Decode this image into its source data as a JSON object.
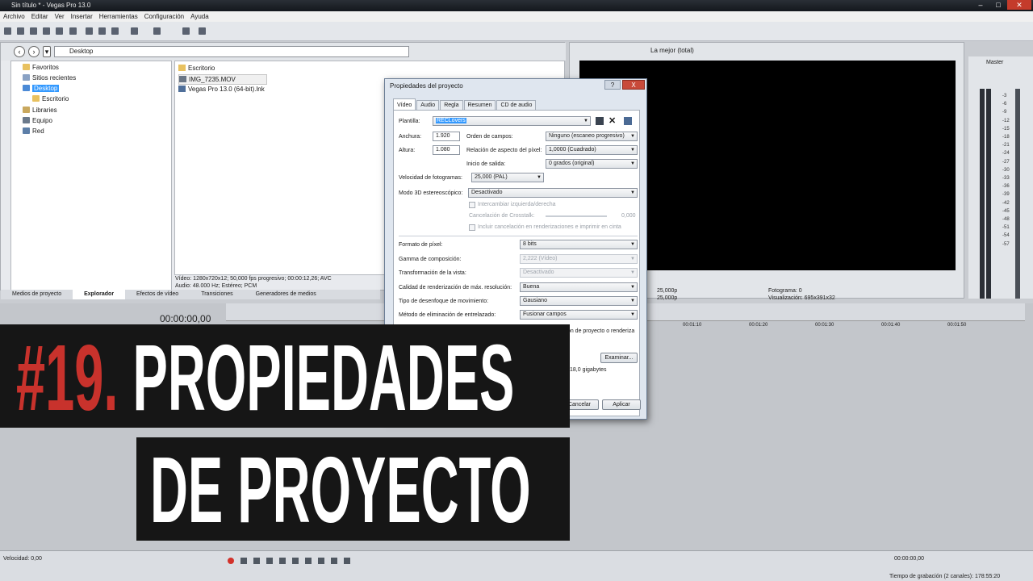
{
  "window": {
    "title": "Sin título * - Vegas Pro 13.0"
  },
  "menu": [
    "Archivo",
    "Editar",
    "Ver",
    "Insertar",
    "Herramientas",
    "Configuración",
    "Ayuda"
  ],
  "explorer": {
    "path": "Desktop",
    "tree": [
      "Favoritos",
      "Sitios recientes",
      "Desktop",
      "Escritorio",
      "Libraries",
      "Equipo",
      "Red"
    ],
    "files": [
      "Escritorio",
      "IMG_7235.MOV",
      "Vegas Pro 13.0 (64-bit).lnk"
    ],
    "info_line1": "Vídeo: 1280x720x12; 50,000 fps progresivo; 00:00:12,26; AVC",
    "info_line2": "Audio: 48.000 Hz; Estéreo; PCM",
    "tabs": [
      "Medios de proyecto",
      "Explorador",
      "Efectos de vídeo",
      "Transiciones",
      "Generadores de medios"
    ]
  },
  "preview": {
    "quality": "La mejor (total)",
    "project": "25,000p",
    "preview_val": "25,000p",
    "frame_label": "Fotograma:",
    "frame": "0",
    "display_label": "Visualización:",
    "display": "695x391x32"
  },
  "master": {
    "label": "Master",
    "scale": [
      "3",
      "6",
      "9",
      "12",
      "15",
      "18",
      "21",
      "24",
      "27",
      "30",
      "33",
      "36",
      "39",
      "42",
      "45",
      "48",
      "51",
      "54",
      "57"
    ]
  },
  "timeline": {
    "timecode": "00:00:00,00",
    "ruler": [
      "00:01:10",
      "00:01:20",
      "00:01:30",
      "00:01:40",
      "00:01:50"
    ]
  },
  "bottom": {
    "speed": "Velocidad: 0,00",
    "tc": "00:00:00,00",
    "record_time": "Tiempo de grabación (2 canales): 178:55:20"
  },
  "dialog": {
    "title": "Propiedades del proyecto",
    "help": "?",
    "close": "X",
    "tabs": [
      "Vídeo",
      "Audio",
      "Regla",
      "Resumen",
      "CD de audio"
    ],
    "template_label": "Plantilla:",
    "template_value": "RECLovers",
    "width_label": "Anchura:",
    "width": "1.920",
    "height_label": "Altura:",
    "height": "1.080",
    "field_order_label": "Orden de campos:",
    "field_order": "Ninguno (escaneo progresivo)",
    "pixel_aspect_label": "Relación de aspecto del píxel:",
    "pixel_aspect": "1,0000 (Cuadrado)",
    "output_rot_label": "Inicio de salida:",
    "output_rot": "0 grados (original)",
    "fps_label": "Velocidad de fotogramas:",
    "fps": "25,000 (PAL)",
    "stereo_label": "Modo 3D estereoscópico:",
    "stereo": "Desactivado",
    "swap_lr": "Intercambiar izquierda/derecha",
    "crosstalk_label": "Cancelación de Crosstalk:",
    "crosstalk": "0,000",
    "crosstalk_include": "Incluir cancelación en renderizaciones e imprimir en cinta",
    "pixel_format_label": "Formato de píxel:",
    "pixel_format": "8 bits",
    "gamma_label": "Gamma de composición:",
    "gamma": "2,222 (Vídeo)",
    "view_transform_label": "Transformación de la vista:",
    "view_transform": "Desactivado",
    "render_quality_label": "Calidad de renderización de máx. resolución:",
    "render_quality": "Buena",
    "motion_blur_label": "Tipo de desenfoque de movimiento:",
    "motion_blur": "Gausiano",
    "deinterlace_label": "Método de eliminación de entrelazado:",
    "deinterlace": "Fusionar campos",
    "adjust_media": "Ajustar medios de origen para que coincidan con la configuración de proyecto o renderiza",
    "browse": "Examinar...",
    "free_space": "18,0 gigabytes",
    "cancel": "Cancelar",
    "apply": "Aplicar"
  },
  "overlay": {
    "number": "#19.",
    "line1": "PROPIEDADES",
    "line2": "DE PROYECTO"
  }
}
